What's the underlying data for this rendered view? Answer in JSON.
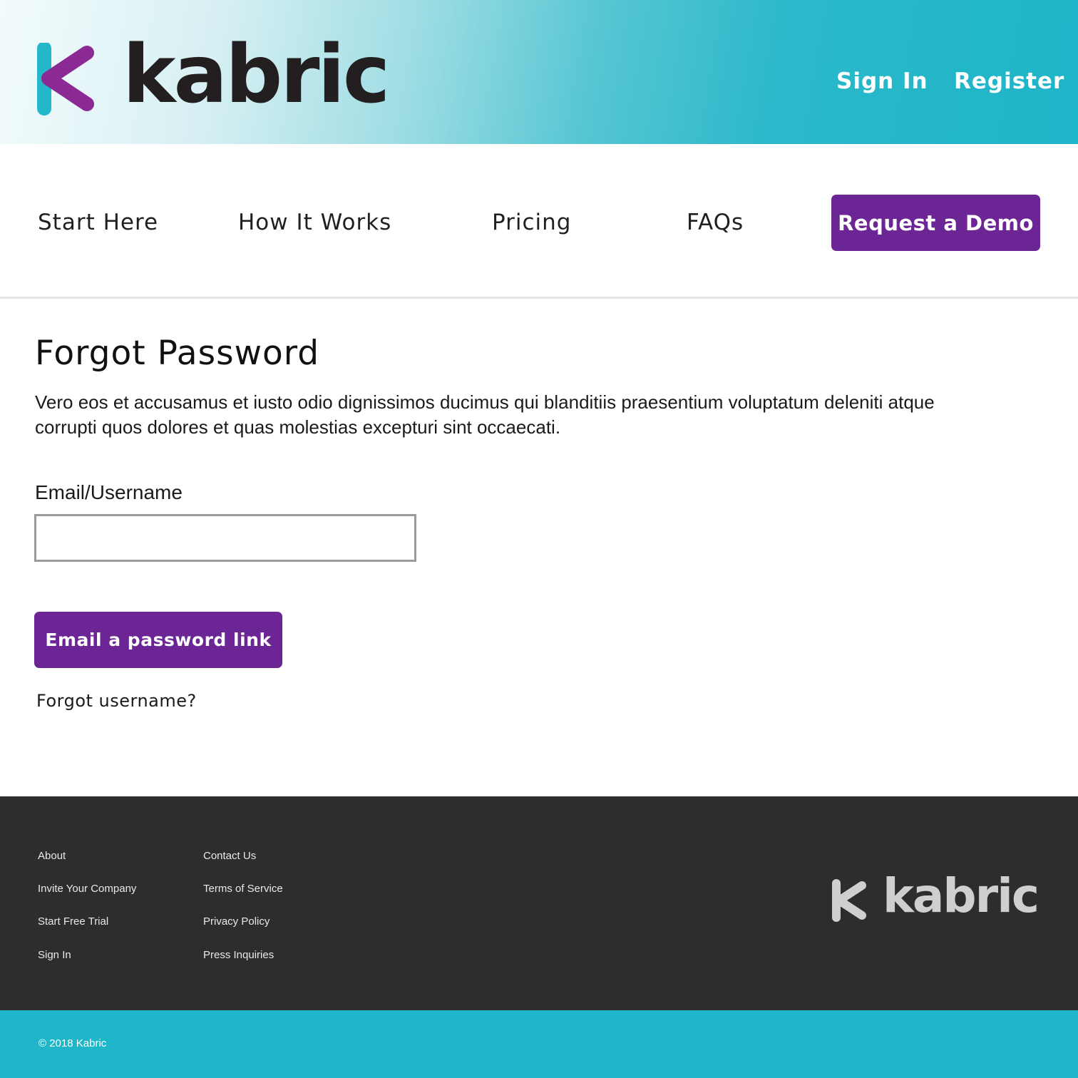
{
  "header": {
    "logo_text": "kabric",
    "links": [
      {
        "label": "Sign In"
      },
      {
        "label": "Register"
      }
    ]
  },
  "nav": {
    "items": [
      {
        "label": "Start Here"
      },
      {
        "label": "How It Works"
      },
      {
        "label": "Pricing"
      },
      {
        "label": "FAQs"
      }
    ],
    "cta_label": "Request a Demo"
  },
  "main": {
    "title": "Forgot Password",
    "intro": "Vero eos et accusamus et iusto odio dignissimos ducimus qui blanditiis praesentium voluptatum deleniti atque corrupti quos dolores et quas molestias excepturi sint occaecati.",
    "field_label": "Email/Username",
    "field_value": "",
    "field_placeholder": "",
    "submit_label": "Email a password link",
    "forgot_username_label": "Forgot username?"
  },
  "footer": {
    "col1": [
      {
        "label": "About"
      },
      {
        "label": "Invite Your Company"
      },
      {
        "label": "Start Free Trial"
      },
      {
        "label": "Sign In"
      }
    ],
    "col2": [
      {
        "label": "Contact Us"
      },
      {
        "label": "Terms of Service"
      },
      {
        "label": "Privacy Policy"
      },
      {
        "label": "Press Inquiries"
      }
    ],
    "logo_text": "kabric",
    "copyright": "© 2018 Kabric"
  },
  "colors": {
    "brand_purple": "#6b2595",
    "brand_teal": "#1eb6c8",
    "footer_bg": "#2d2d2d"
  },
  "icons": {
    "header_logo": "kabric-k-logo-icon",
    "footer_logo": "kabric-k-logo-icon"
  }
}
